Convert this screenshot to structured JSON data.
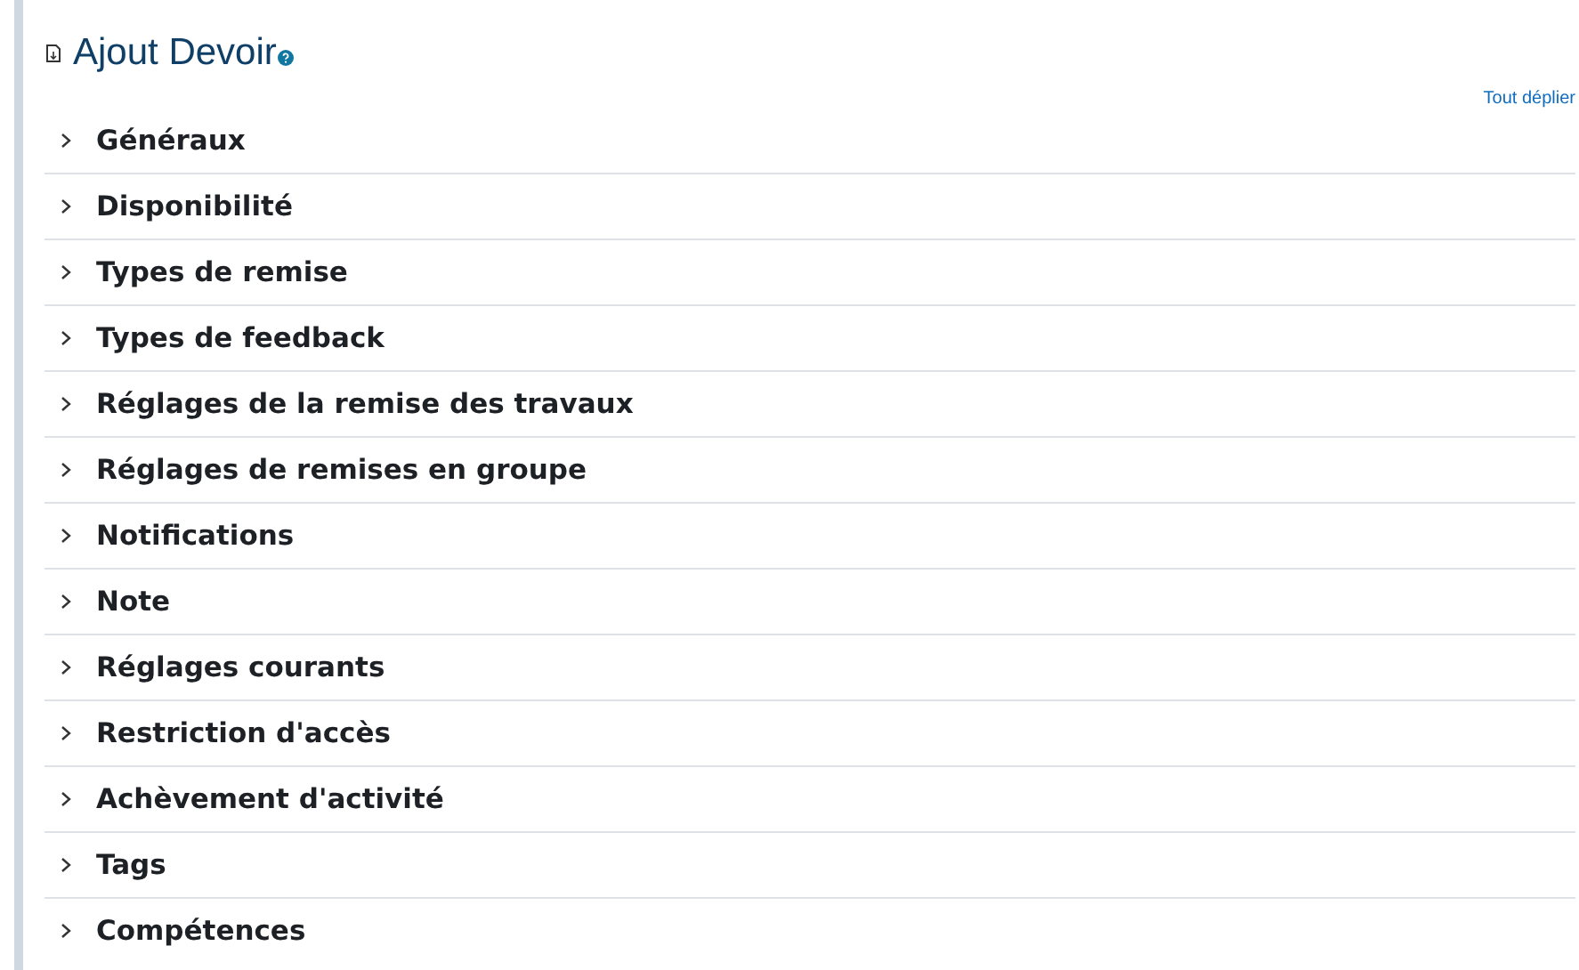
{
  "heading": {
    "title": "Ajout Devoir"
  },
  "expand_all": "Tout déplier",
  "sections": [
    {
      "label": "Généraux",
      "expanded": false
    },
    {
      "label": "Disponibilité",
      "expanded": false
    },
    {
      "label": "Types de remise",
      "expanded": false
    },
    {
      "label": "Types de feedback",
      "expanded": false
    },
    {
      "label": "Réglages de la remise des travaux",
      "expanded": false
    },
    {
      "label": "Réglages de remises en groupe",
      "expanded": false
    },
    {
      "label": "Notifications",
      "expanded": false
    },
    {
      "label": "Note",
      "expanded": false
    },
    {
      "label": "Réglages courants",
      "expanded": false
    },
    {
      "label": "Restriction d'accès",
      "expanded": false
    },
    {
      "label": "Achèvement d'activité",
      "expanded": false
    },
    {
      "label": "Tags",
      "expanded": false
    },
    {
      "label": "Compétences",
      "expanded": false
    }
  ]
}
